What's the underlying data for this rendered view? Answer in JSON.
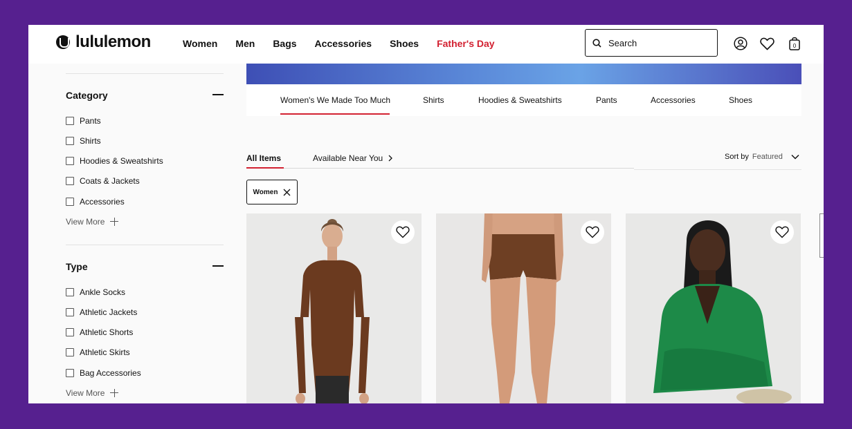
{
  "brand": {
    "name": "lululemon"
  },
  "nav": {
    "items": [
      "Women",
      "Men",
      "Bags",
      "Accessories",
      "Shoes"
    ],
    "highlight": "Father's Day",
    "highlight_color": "#d22030"
  },
  "search": {
    "placeholder": "Search"
  },
  "header_icons": [
    "account-icon",
    "heart-icon",
    "bag-icon"
  ],
  "cart": {
    "count": "0"
  },
  "sidebar": {
    "category": {
      "title": "Category",
      "options": [
        "Pants",
        "Shirts",
        "Hoodies & Sweatshirts",
        "Coats & Jackets",
        "Accessories"
      ],
      "view_more": "View More"
    },
    "type": {
      "title": "Type",
      "options": [
        "Ankle Socks",
        "Athletic Jackets",
        "Athletic Shorts",
        "Athletic Skirts",
        "Bag Accessories"
      ],
      "view_more": "View More"
    }
  },
  "subnav": {
    "items": [
      "Women's We Made Too Much",
      "Shirts",
      "Hoodies & Sweatshirts",
      "Pants",
      "Accessories",
      "Shoes"
    ],
    "active_index": 0
  },
  "listing": {
    "tabs": {
      "all": "All Items",
      "near": "Available Near You"
    },
    "sort": {
      "label": "Sort by",
      "value": "Featured"
    },
    "filter_chip": "Women",
    "accent_color": "#d22030"
  },
  "products": [
    {
      "image": "woman in brown long-sleeve top"
    },
    {
      "image": "model in brown shorts"
    },
    {
      "image": "woman in green knit cardigan"
    }
  ]
}
